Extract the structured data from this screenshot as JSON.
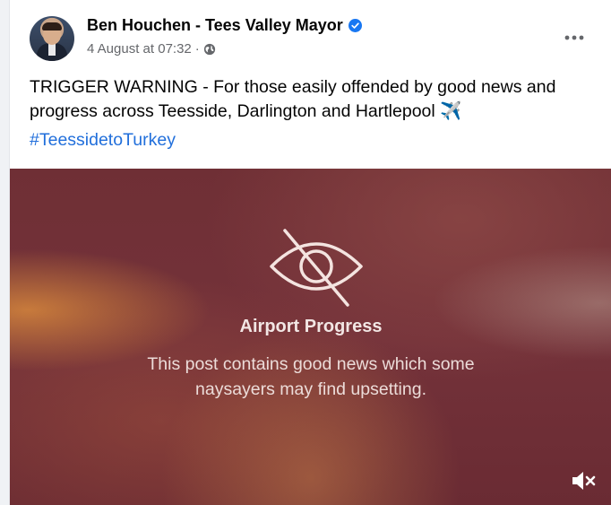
{
  "post": {
    "author": "Ben Houchen - Tees Valley Mayor",
    "timestamp": "4 August at 07:32",
    "separator": "·",
    "privacy_icon": "globe-icon",
    "verified_icon": "verified-badge-icon",
    "more_icon": "more-options-icon",
    "text": "TRIGGER WARNING - For those easily offended by good news and progress across Teesside, Darlington and Hartlepool ✈️",
    "hashtag": "#TeessidetoTurkey"
  },
  "media": {
    "overlay_icon": "eye-slash-icon",
    "title": "Airport Progress",
    "description": "This post contains good news which some naysayers may find upsetting.",
    "mute_icon": "volume-muted-icon"
  },
  "colors": {
    "link": "#216fdb",
    "verified": "#1877f2",
    "secondary_text": "#65676b"
  }
}
